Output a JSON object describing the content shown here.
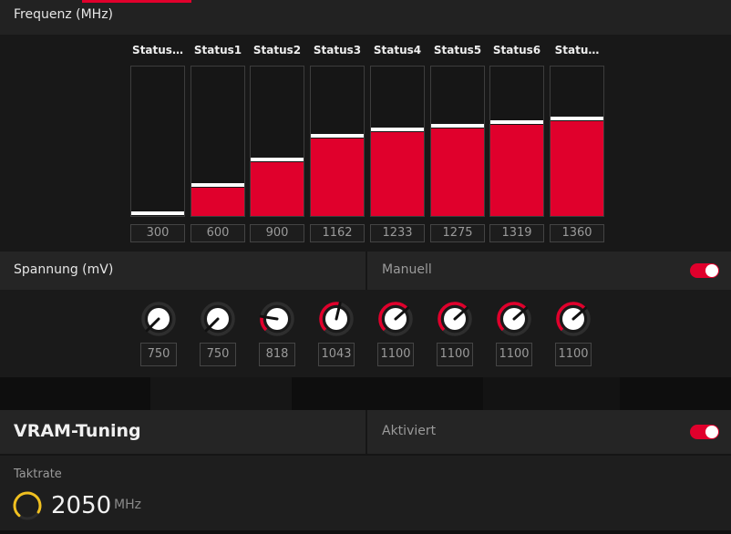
{
  "frequency": {
    "title": "Frequenz (MHz)",
    "columns": [
      {
        "label": "Status…",
        "value": "300",
        "fill": 0.0
      },
      {
        "label": "Status1",
        "value": "600",
        "fill": 0.19
      },
      {
        "label": "Status2",
        "value": "900",
        "fill": 0.36
      },
      {
        "label": "Status3",
        "value": "1162",
        "fill": 0.52
      },
      {
        "label": "Status4",
        "value": "1233",
        "fill": 0.56
      },
      {
        "label": "Status5",
        "value": "1275",
        "fill": 0.585
      },
      {
        "label": "Status6",
        "value": "1319",
        "fill": 0.61
      },
      {
        "label": "Statu…",
        "value": "1360",
        "fill": 0.635
      }
    ]
  },
  "voltage": {
    "title": "Spannung (mV)",
    "mode_label": "Manuell",
    "toggle_on": true,
    "values": [
      {
        "value": "750",
        "level": 0.0
      },
      {
        "value": "750",
        "level": 0.0
      },
      {
        "value": "818",
        "level": 0.2
      },
      {
        "value": "1043",
        "level": 0.55
      },
      {
        "value": "1100",
        "level": 0.68
      },
      {
        "value": "1100",
        "level": 0.68
      },
      {
        "value": "1100",
        "level": 0.68
      },
      {
        "value": "1100",
        "level": 0.68
      }
    ]
  },
  "vram": {
    "title": "VRAM-Tuning",
    "mode_label": "Aktiviert",
    "toggle_on": true,
    "clock_label": "Taktrate",
    "clock_value": "2050",
    "clock_unit": "MHz"
  },
  "colors": {
    "accent": "#e0002c",
    "gauge": "#f0c020"
  }
}
